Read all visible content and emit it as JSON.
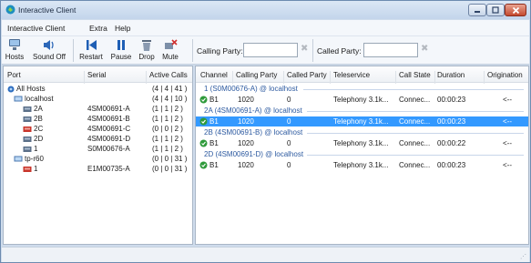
{
  "window": {
    "title": "Interactive Client",
    "controls": {
      "minimize": "−",
      "maximize": "□",
      "close": "×"
    }
  },
  "menu": [
    "Interactive Client",
    "Extra",
    "Help"
  ],
  "toolbar": {
    "hosts": "Hosts",
    "sound_off": "Sound Off",
    "restart": "Restart",
    "pause": "Pause",
    "drop": "Drop",
    "mute": "Mute",
    "calling_party_label": "Calling Party:",
    "calling_party_value": "",
    "called_party_label": "Called Party:",
    "called_party_value": "",
    "clear": "✖"
  },
  "ports": {
    "headers": {
      "port": "Port",
      "serial": "Serial",
      "active": "Active Calls"
    },
    "rows": [
      {
        "port": "All Hosts",
        "serial": "",
        "active": "(4 | 4 | 41 )",
        "icon": "all-hosts-icon",
        "level": 0
      },
      {
        "port": "localhost",
        "serial": "",
        "active": "(4 | 4 | 10 )",
        "icon": "host-icon",
        "level": 1
      },
      {
        "port": "2A",
        "serial": "4SM00691-A",
        "active": "(1 | 1 | 2 )",
        "icon": "port-icon",
        "level": 2
      },
      {
        "port": "2B",
        "serial": "4SM00691-B",
        "active": "(1 | 1 | 2 )",
        "icon": "port-icon",
        "level": 2
      },
      {
        "port": "2C",
        "serial": "4SM00691-C",
        "active": "(0 | 0 | 2 )",
        "icon": "port-error-icon",
        "level": 2
      },
      {
        "port": "2D",
        "serial": "4SM00691-D",
        "active": "(1 | 1 | 2 )",
        "icon": "port-icon",
        "level": 2
      },
      {
        "port": "1",
        "serial": "S0M00676-A",
        "active": "(1 | 1 | 2 )",
        "icon": "port-icon",
        "level": 2
      },
      {
        "port": "tp-r60",
        "serial": "",
        "active": "(0 | 0 | 31 )",
        "icon": "host-icon",
        "level": 1
      },
      {
        "port": "1",
        "serial": "E1M00735-A",
        "active": "(0 | 0 | 31 )",
        "icon": "port-error-icon",
        "level": 2
      }
    ]
  },
  "calls": {
    "headers": {
      "channel": "Channel",
      "calling": "Calling Party",
      "called": "Called Party",
      "teleservice": "Teleservice",
      "state": "Call State",
      "duration": "Duration",
      "origination": "Origination"
    },
    "groups": [
      {
        "label": "1 (S0M00676-A) @ localhost",
        "call": {
          "channel": "B1",
          "calling": "1020",
          "called": "0",
          "teleservice": "Telephony 3.1k...",
          "state": "Connec...",
          "duration": "00:00:23",
          "origination": "<--"
        },
        "selected": false
      },
      {
        "label": "2A (4SM00691-A) @ localhost",
        "call": {
          "channel": "B1",
          "calling": "1020",
          "called": "0",
          "teleservice": "Telephony 3.1k...",
          "state": "Connec...",
          "duration": "00:00:23",
          "origination": "<--"
        },
        "selected": true
      },
      {
        "label": "2B (4SM00691-B) @ localhost",
        "call": {
          "channel": "B1",
          "calling": "1020",
          "called": "0",
          "teleservice": "Telephony 3.1k...",
          "state": "Connec...",
          "duration": "00:00:22",
          "origination": "<--"
        },
        "selected": false
      },
      {
        "label": "2D (4SM00691-D) @ localhost",
        "call": {
          "channel": "B1",
          "calling": "1020",
          "called": "0",
          "teleservice": "Telephony 3.1k...",
          "state": "Connec...",
          "duration": "00:00:23",
          "origination": "<--"
        },
        "selected": false
      }
    ]
  },
  "colors": {
    "selection": "#3399ff",
    "group_text": "#2d5aa0",
    "accent": "#1e4f9c"
  }
}
